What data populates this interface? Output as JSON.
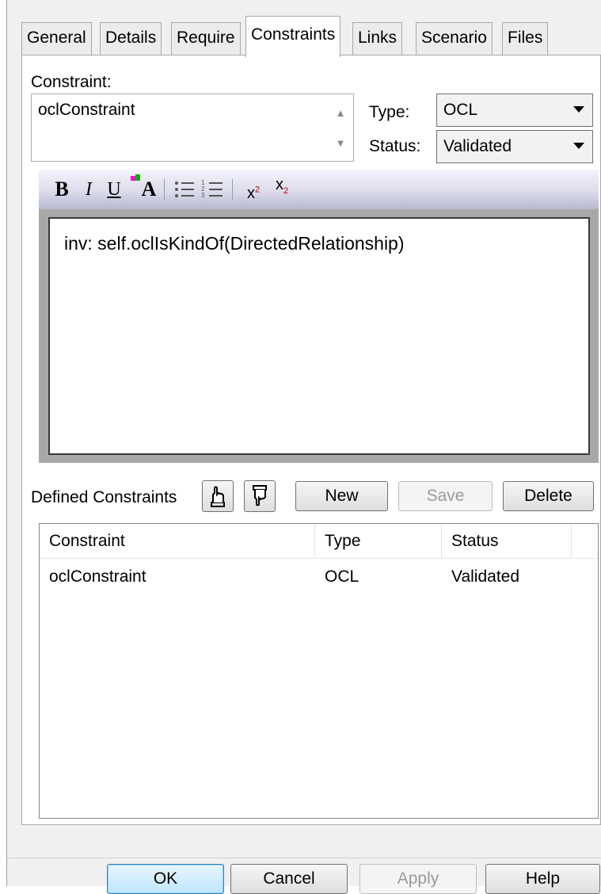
{
  "tabs": [
    "General",
    "Details",
    "Require",
    "Constraints",
    "Links",
    "Scenario",
    "Files"
  ],
  "active_tab": "Constraints",
  "constraint_label": "Constraint:",
  "constraint_name": "oclConstraint",
  "type_label": "Type:",
  "type_value": "OCL",
  "status_label": "Status:",
  "status_value": "Validated",
  "toolbar": {
    "bold": "B",
    "italic": "I",
    "underline": "U",
    "color": "A",
    "subscript_base": "x",
    "sup_mark": "2",
    "sub_mark": "2"
  },
  "editor_text": "inv: self.oclIsKindOf(DirectedRelationship)",
  "defined_constraints_label": "Defined Constraints",
  "buttons": {
    "new": "New",
    "save": "Save",
    "delete": "Delete"
  },
  "table": {
    "columns": [
      "Constraint",
      "Type",
      "Status"
    ],
    "rows": [
      [
        "oclConstraint",
        "OCL",
        "Validated"
      ]
    ]
  },
  "dialog_buttons": {
    "ok": "OK",
    "cancel": "Cancel",
    "apply": "Apply",
    "help": "Help"
  },
  "colors": {
    "toolbar_accent": "#b8b8d0",
    "default_button": "#3c7fb1"
  }
}
